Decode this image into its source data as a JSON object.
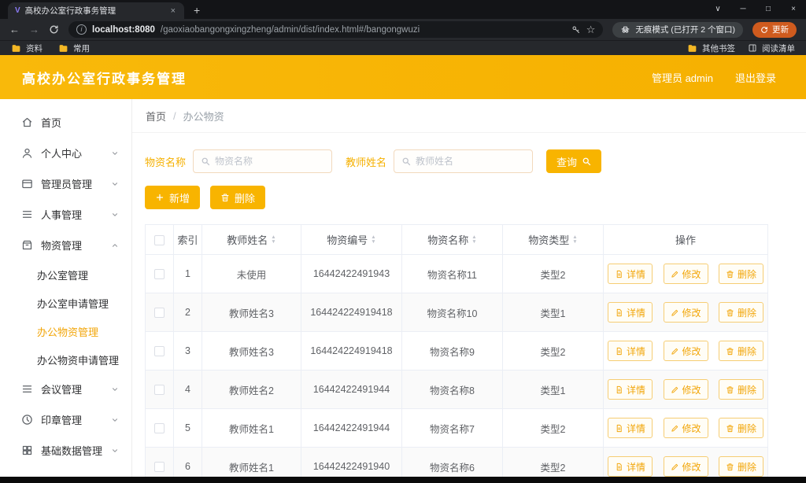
{
  "browser": {
    "tab": {
      "favicon": "V",
      "title": "高校办公室行政事务管理",
      "close": "×"
    },
    "new_tab": "+",
    "window_controls": {
      "tab_search": "∨",
      "minimize": "─",
      "maximize": "□",
      "close": "×"
    },
    "nav": {
      "back": "←",
      "forward": "→",
      "info": "i"
    },
    "url": {
      "host": "localhost:8080",
      "path": "/gaoxiaobangongxingzheng/admin/dist/index.html#/bangongwuzi"
    },
    "star": "☆",
    "incognito_badge": "无痕模式 (已打开 2 个窗口)",
    "update_button": "更新",
    "bookmarks": {
      "left": [
        "资料",
        "常用"
      ],
      "other": "其他书签",
      "reading": "阅读清单"
    }
  },
  "header": {
    "title": "高校办公室行政事务管理",
    "user": "管理员 admin",
    "logout": "退出登录"
  },
  "sidebar": {
    "items": [
      {
        "label": "首页"
      },
      {
        "label": "个人中心"
      },
      {
        "label": "管理员管理"
      },
      {
        "label": "人事管理"
      },
      {
        "label": "物资管理"
      },
      {
        "label": "会议管理"
      },
      {
        "label": "印章管理"
      },
      {
        "label": "基础数据管理"
      }
    ],
    "submenu": [
      "办公室管理",
      "办公室申请管理",
      "办公物资管理",
      "办公物资申请管理"
    ],
    "active_item": "办公物资管理"
  },
  "breadcrumb": {
    "home": "首页",
    "separator": "/",
    "current": "办公物资"
  },
  "filters": {
    "name_label": "物资名称",
    "name_placeholder": "物资名称",
    "teacher_label": "教师姓名",
    "teacher_placeholder": "教师姓名",
    "search_button": "查询"
  },
  "toolbar": {
    "add": "新增",
    "delete": "删除"
  },
  "table": {
    "sort_up": "▲",
    "sort_down": "▼",
    "headers": {
      "index": "索引",
      "teacher": "教师姓名",
      "code": "物资编号",
      "name": "物资名称",
      "type": "物资类型",
      "actions": "操作"
    },
    "action_detail": "详情",
    "action_edit": "修改",
    "action_delete": "删除",
    "rows": [
      {
        "index": "1",
        "teacher": "未使用",
        "code": "16442422491943",
        "name": "物资名称11",
        "type": "类型2"
      },
      {
        "index": "2",
        "teacher": "教师姓名3",
        "code": "164424224919418",
        "name": "物资名称10",
        "type": "类型1"
      },
      {
        "index": "3",
        "teacher": "教师姓名3",
        "code": "164424224919418",
        "name": "物资名称9",
        "type": "类型2"
      },
      {
        "index": "4",
        "teacher": "教师姓名2",
        "code": "16442422491944",
        "name": "物资名称8",
        "type": "类型1"
      },
      {
        "index": "5",
        "teacher": "教师姓名1",
        "code": "16442422491944",
        "name": "物资名称7",
        "type": "类型2"
      },
      {
        "index": "6",
        "teacher": "教师姓名1",
        "code": "16442422491940",
        "name": "物资名称6",
        "type": "类型2"
      }
    ]
  },
  "colors": {
    "primary": "#f8b400",
    "active_link": "#f2a60a",
    "header_gradient": [
      "#f9b90a",
      "#f6b000"
    ]
  }
}
